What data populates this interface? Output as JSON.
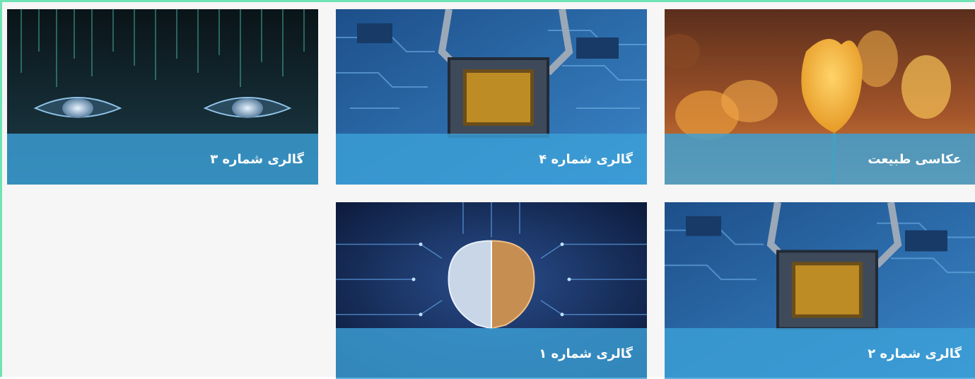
{
  "gallery": {
    "items": [
      {
        "title": "عکاسی طبیعت",
        "image": "tulip-flowers-photo"
      },
      {
        "title": "گالری شماره ۴",
        "image": "ai-chip-robot-photo"
      },
      {
        "title": "گالری شماره ۳",
        "image": "digital-face-eyes-photo"
      },
      {
        "title": "گالری شماره ۲",
        "image": "ai-chip-robot-photo"
      },
      {
        "title": "گالری شماره ۱",
        "image": "circuit-brain-photo"
      }
    ]
  },
  "colors": {
    "frame_border": "#6fe3b5",
    "caption_overlay": "#3ca0d7",
    "page_bg": "#f6f6f6"
  }
}
